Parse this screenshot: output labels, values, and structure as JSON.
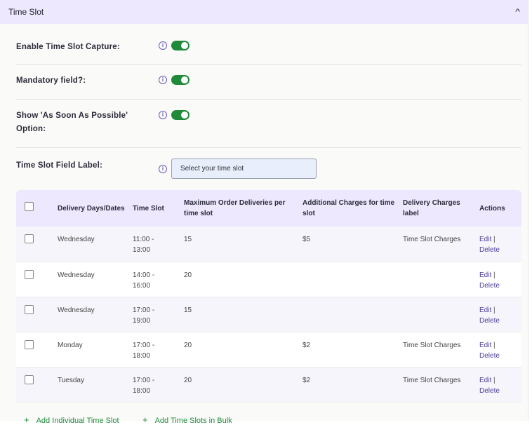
{
  "header": {
    "title": "Time Slot",
    "collapse_icon": "chevron-up"
  },
  "settings": [
    {
      "label": "Enable Time Slot Capture:",
      "enabled": true
    },
    {
      "label": "Mandatory field?:",
      "enabled": true
    },
    {
      "label_line1": "Show 'As Soon As Possible'",
      "label_line2": "Option:",
      "enabled": true
    }
  ],
  "field_label": {
    "label": "Time Slot Field Label:",
    "value": "Select your time slot"
  },
  "table": {
    "headers": {
      "days": "Delivery Days/Dates",
      "slot": "Time Slot",
      "max": "Maximum Order Deliveries per time slot",
      "charges": "Additional Charges for time slot",
      "label": "Delivery Charges label",
      "actions": "Actions"
    },
    "rows": [
      {
        "day": "Wednesday",
        "from": "11:00 -",
        "to": "13:00",
        "max": "15",
        "charge": "$5",
        "label": "Time Slot Charges"
      },
      {
        "day": "Wednesday",
        "from": "14:00 -",
        "to": "16:00",
        "max": "20",
        "charge": "",
        "label": ""
      },
      {
        "day": "Wednesday",
        "from": "17:00 -",
        "to": "19:00",
        "max": "15",
        "charge": "",
        "label": ""
      },
      {
        "day": "Monday",
        "from": "17:00 -",
        "to": "18:00",
        "max": "20",
        "charge": "$2",
        "label": "Time Slot Charges"
      },
      {
        "day": "Tuesday",
        "from": "17:00 -",
        "to": "18:00",
        "max": "20",
        "charge": "$2",
        "label": "Time Slot Charges"
      }
    ],
    "edit": "Edit",
    "sep": "|",
    "delete": "Delete"
  },
  "add_individual": "Add Individual Time Slot",
  "add_bulk": "Add Time Slots in Bulk",
  "plus": "+"
}
